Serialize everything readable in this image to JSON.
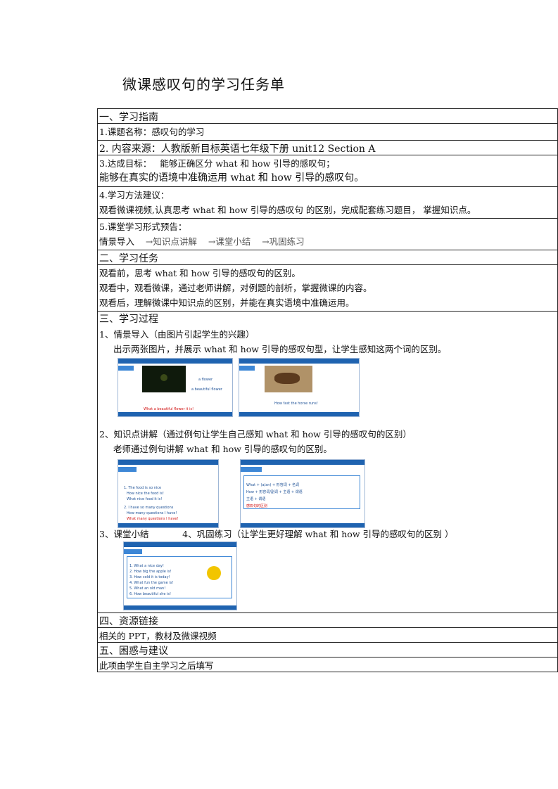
{
  "title": "微课感叹句的学习任务单",
  "sec1": {
    "heading": "一、学习指南",
    "topic": "1.课题名称：感叹句的学习",
    "source": "2. 内容来源：人教版新目标英语七年级下册 unit12 Section A",
    "goal_label": "3.达成目标：",
    "goal_1": "能够正确区分 what  和 how  引导的感叹句；",
    "goal_2": "能够在真实的语境中准确运用 what  和 how  引导的感叹句。",
    "method_label": "4.学习方法建议：",
    "method_text": "观看微课视频,认真思考 what  和 how  引导的感叹句  的区别，完成配套练习题目，  掌握知识点。",
    "form_label": "5.课堂学习形式预告：",
    "form_steps": [
      "情景导入",
      "→知识点讲解",
      "→课堂小结",
      "→巩固练习"
    ]
  },
  "sec2": {
    "heading": "二、学习任务",
    "before": "观看前，思考 what  和 how  引导的感叹句的区别。",
    "during": "观看中，观看微课，通过老师讲解，对例题的剖析，掌握微课的内容。",
    "after": "观看后，理解微课中知识点的区别，并能在真实语境中准确运用。"
  },
  "sec3": {
    "heading": "三、学习过程",
    "step1": "1、情景导入（由图片引起学生的兴趣）",
    "step1_desc": "出示两张图片，并展示 what 和 how 引导的感叹句型，让学生感知这两个词的区别。",
    "slide1": {
      "line1": "a flower",
      "line2": "a beautiful flower",
      "red": "What a beautiful flower it is!"
    },
    "slide2": {
      "line1": "How fast the horse runs!"
    },
    "step2": "2、知识点讲解（通过例句让学生自己感知 what  和 how  引导的感叹句的区别）",
    "step2_desc": "老师通过例句讲解 what  和 how  引导的感叹句的区别。",
    "slide3": {
      "lines": [
        "1. The food is so nice",
        "How nice the food is!",
        "What nice food it is!",
        "2. I have so many questions",
        "How many questions I have!",
        "What many questions I have!"
      ]
    },
    "slide4": {
      "lines": [
        "What + (a/an) + 形容词 + 名词",
        "How + 形容词/副词 + 主语 + 谓语",
        "主语 + 谓语",
        "感叹句的区别"
      ]
    },
    "step3": "3、课堂小结",
    "step4": "4、巩固练习（让学生更好理解 what  和 how  引导的感叹句的区别  ）",
    "slide5": {
      "lines": [
        "1. What a nice day!",
        "2. How big the apple is!",
        "3. How cold it is today!",
        "4. What fun the game is!",
        "5. What an old man!",
        "6. How beautiful she is!"
      ]
    }
  },
  "sec4": {
    "heading": "四、资源链接",
    "text": "相关的 PPT，教材及微课视频"
  },
  "sec5": {
    "heading": "五、困惑与建议",
    "text": " 此项由学生自主学习之后填写"
  },
  "colors": {
    "slide_blue": "#1f63b0",
    "accent_red": "#d01010"
  }
}
